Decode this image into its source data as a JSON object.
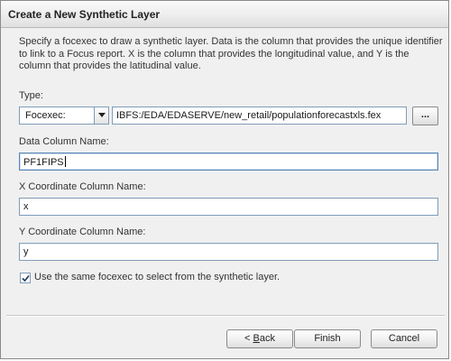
{
  "window": {
    "title": "Create a New Synthetic Layer"
  },
  "description": "Specify a focexec to draw a synthetic layer. Data is the column that provides the unique identifier to link to a Focus report. X is the column that provides the longitudinal value, and Y is the column that provides the latitudinal value.",
  "type": {
    "label": "Type:",
    "selected": "Focexec:",
    "path": "IBFS:/EDA/EDASERVE/new_retail/populationforecastxls.fex",
    "browse_label": "..."
  },
  "data_column": {
    "label": "Data Column Name:",
    "value": "PF1FIPS"
  },
  "x_column": {
    "label": "X Coordinate Column Name:",
    "value": "x"
  },
  "y_column": {
    "label": "Y Coordinate Column Name:",
    "value": "y"
  },
  "same_focexec": {
    "label": "Use the same focexec to select from the synthetic layer.",
    "checked": true
  },
  "buttons": {
    "back_prefix": "< ",
    "back_accel": "B",
    "back_rest": "ack",
    "finish": "Finish",
    "cancel": "Cancel"
  },
  "colors": {
    "dialog_bg": "#f0f0f0",
    "input_border": "#7f9db9",
    "focus_border": "#5c86b5"
  }
}
